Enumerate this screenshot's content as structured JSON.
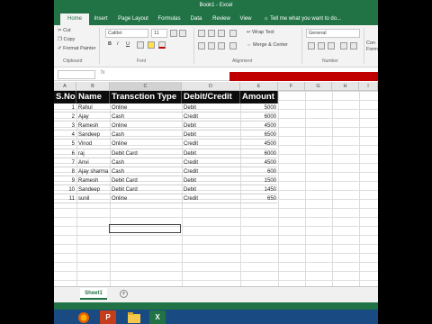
{
  "window": {
    "title": "Book1 - Excel"
  },
  "ribbon_tabs": [
    "Home",
    "Insert",
    "Page Layout",
    "Formulas",
    "Data",
    "Review",
    "View"
  ],
  "tell_me": "Tell me what you want to do...",
  "ribbon": {
    "clipboard": {
      "cut": "Cut",
      "copy": "Copy",
      "format_painter": "Format Painter",
      "group": "Clipboard"
    },
    "font": {
      "name": "Calibri",
      "size": "11",
      "bold": "B",
      "italic": "I",
      "underline": "U",
      "group": "Font"
    },
    "alignment": {
      "wrap": "Wrap Text",
      "merge": "Merge & Center",
      "group": "Alignment"
    },
    "number": {
      "format": "General",
      "group": "Number"
    },
    "styles": {
      "cond1": "Con",
      "cond2": "Form"
    }
  },
  "formula_bar": {
    "fx": "fx"
  },
  "columns": [
    "A",
    "B",
    "C",
    "D",
    "E",
    "F",
    "G",
    "H",
    "I"
  ],
  "table": {
    "headers": [
      "S.No",
      "Name",
      "Transction Type",
      "Debit/Credit",
      "Amount"
    ],
    "rows": [
      [
        "1",
        "Rahul",
        "Online",
        "Debit",
        "5000"
      ],
      [
        "2",
        "Ajay",
        "Cash",
        "Credit",
        "6000"
      ],
      [
        "3",
        "Ramesh",
        "Online",
        "Debit",
        "4500"
      ],
      [
        "4",
        "Sandeep",
        "Cash",
        "Debit",
        "6500"
      ],
      [
        "5",
        "Vinod",
        "Online",
        "Credit",
        "4500"
      ],
      [
        "6",
        "raj",
        "Debit Card",
        "Debit",
        "6000"
      ],
      [
        "7",
        "Anvi",
        "Cash",
        "Credit",
        "4500"
      ],
      [
        "8",
        "Ajay sharma",
        "Cash",
        "Credit",
        "600"
      ],
      [
        "9",
        "Ramesh",
        "Debit Card",
        "Debit",
        "1500"
      ],
      [
        "10",
        "Sandeep",
        "Debit Card",
        "Debit",
        "1450"
      ],
      [
        "11",
        "sunil",
        "Online",
        "Credit",
        "650"
      ]
    ]
  },
  "sheet_tabs": [
    "Sheet1"
  ],
  "colors": {
    "excel_green": "#217346",
    "banner_red": "#c00000",
    "header_black": "#0d0d0d"
  },
  "taskbar": {
    "apps": [
      "firefox-icon",
      "powerpoint-icon",
      "file-explorer-icon",
      "excel-icon"
    ]
  }
}
